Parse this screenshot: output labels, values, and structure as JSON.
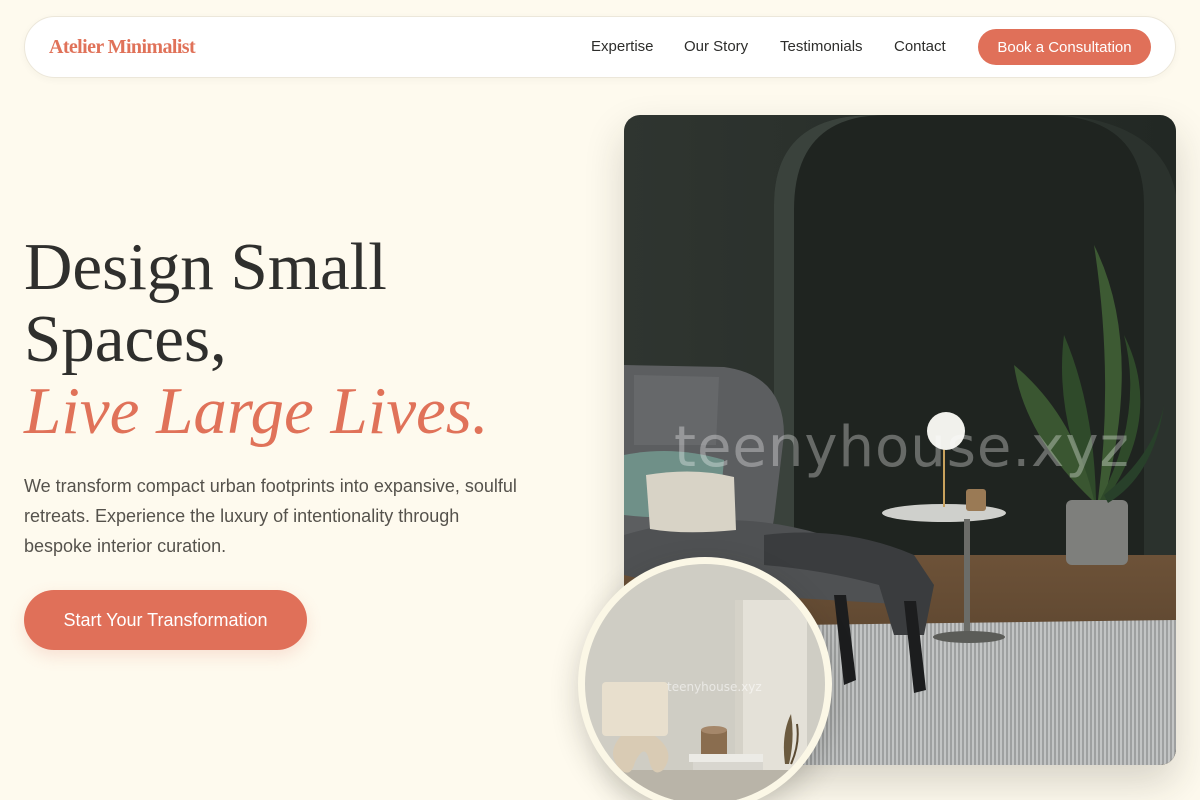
{
  "brand": {
    "name": "Atelier Minimalist"
  },
  "nav": {
    "links": [
      {
        "label": "Expertise"
      },
      {
        "label": "Our Story"
      },
      {
        "label": "Testimonials"
      },
      {
        "label": "Contact"
      }
    ],
    "cta_label": "Book a Consultation"
  },
  "hero": {
    "headline_line1": "Design Small",
    "headline_line2": "Spaces,",
    "headline_accent": "Live Large Lives.",
    "subtitle": "We transform compact urban footprints into expansive, soulful retreats. Experience the luxury of intentionality through bespoke interior curation.",
    "cta_label": "Start Your Transformation"
  },
  "images": {
    "main_watermark": "teenyhouse.xyz",
    "inset_watermark": "teenyhouse.xyz"
  },
  "colors": {
    "background": "#fefaee",
    "accent": "#e07259",
    "text": "#2f2f2d",
    "muted_text": "#55524c"
  }
}
